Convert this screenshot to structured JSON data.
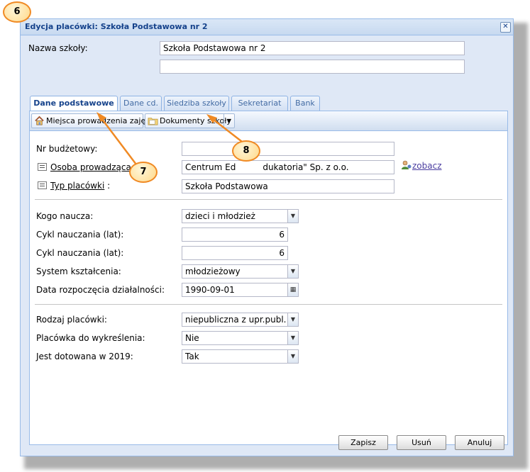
{
  "window": {
    "title": "Edycja placówki: Szkoła Podstawowa nr 2",
    "close_glyph": "✕"
  },
  "school_name": {
    "label": "Nazwa szkoły:",
    "value": "Szkoła Podstawowa nr 2",
    "value2": ""
  },
  "tabs": [
    {
      "label": "Dane podstawowe",
      "active": true
    },
    {
      "label": "Dane cd.",
      "active": false
    },
    {
      "label": "Siedziba szkoły",
      "active": false
    },
    {
      "label": "Sekretariat",
      "active": false
    },
    {
      "label": "Bank",
      "active": false
    }
  ],
  "toolbar": {
    "places_button": "Miejsca prowadzenia zajęć",
    "docs_button": "Dokumenty szkoły"
  },
  "form": {
    "budget_label": "Nr budżetowy:",
    "budget_value": "",
    "operator_label": "Osoba prowadząca :",
    "operator_value": "Centrum Edukacji \"Edukatoria\"  Sp. z o.o.",
    "operator_value_visible": "Centrum Ed",
    "operator_value_tail": "dukatoria\"  Sp. z o.o.",
    "view_link": "zobacz",
    "type_label": "Typ placówki",
    "type_suffix": " :",
    "type_value": "Szkoła Podstawowa",
    "teaches_label": "Kogo naucza:",
    "teaches_value": "dzieci i młodzież",
    "cycle1_label": "Cykl nauczania (lat):",
    "cycle1_value": "6",
    "cycle2_label": "Cykl nauczania (lat):",
    "cycle2_value": "6",
    "system_label": "System kształcenia:",
    "system_value": "młodzieżowy",
    "start_label": "Data rozpoczęcia działalności:",
    "start_value": "1990-09-01",
    "kind_label": "Rodzaj placówki:",
    "kind_value": "niepubliczna z upr.publ.",
    "delete_label": "Placówka do wykreślenia:",
    "delete_value": "Nie",
    "subsidy_label": "Jest dotowana w 2019:",
    "subsidy_value": "Tak"
  },
  "footer": {
    "save": "Zapisz",
    "remove": "Usuń",
    "cancel": "Anuluj"
  },
  "annotations": {
    "badge6": "6",
    "badge7": "7",
    "badge8": "8"
  },
  "colors": {
    "accent": "#15428b",
    "annotation_orange": "#f08a24"
  }
}
